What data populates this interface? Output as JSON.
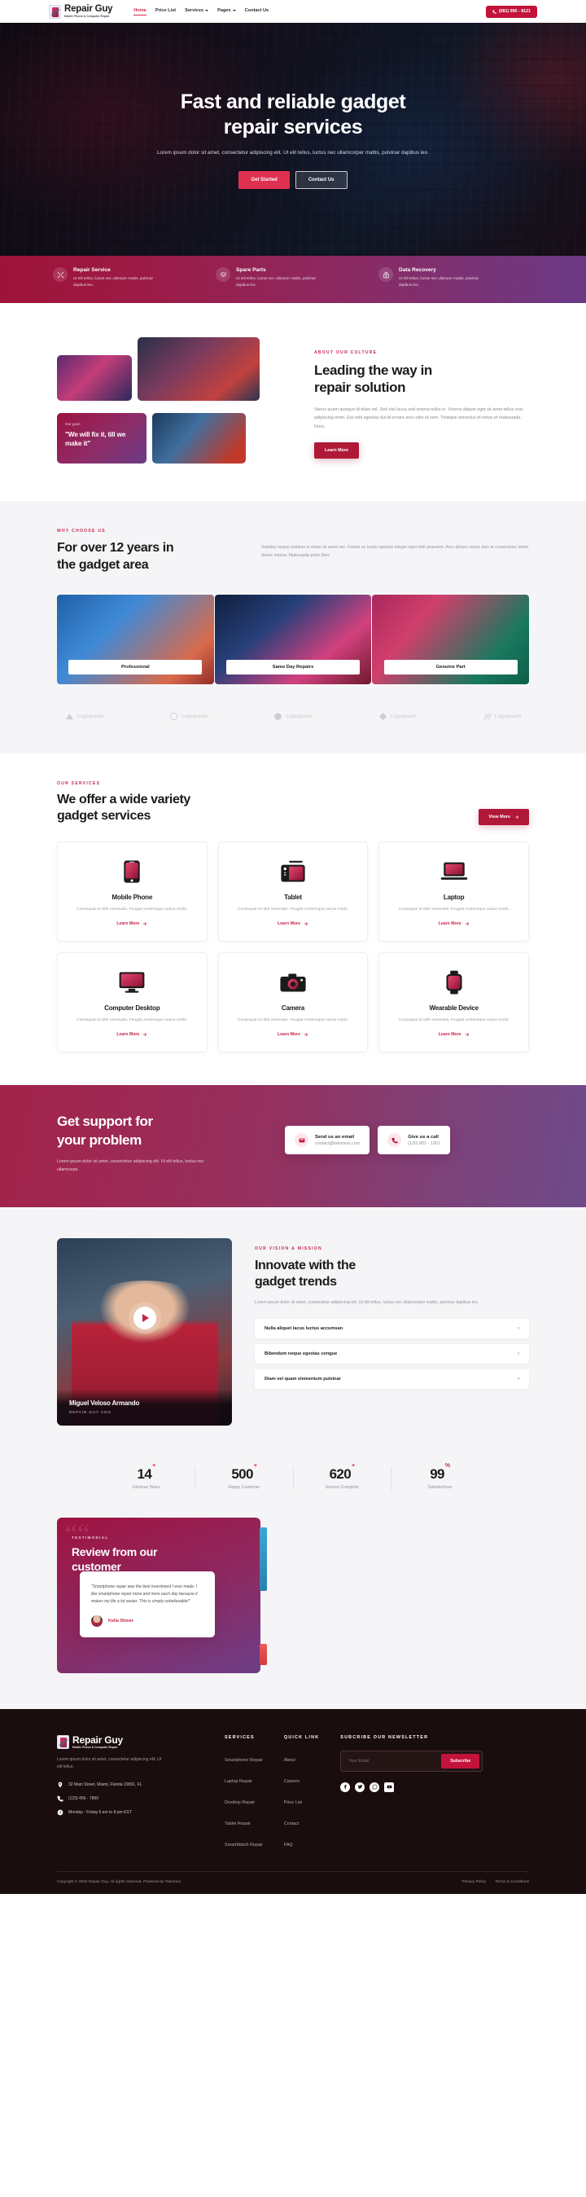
{
  "brand": {
    "name": "Repair Guy",
    "tagline": "Mobile Phone & Computer Repair"
  },
  "nav": {
    "items": [
      {
        "label": "Home",
        "active": true,
        "caret": false
      },
      {
        "label": "Price List",
        "active": false,
        "caret": false
      },
      {
        "label": "Services",
        "active": false,
        "caret": true
      },
      {
        "label": "Pages",
        "active": false,
        "caret": true
      },
      {
        "label": "Contact Us",
        "active": false,
        "caret": false
      }
    ],
    "phone": "(081) 900 - 8121"
  },
  "hero": {
    "title_line1": "Fast and reliable gadget",
    "title_line2": "repair services",
    "subtitle": "Lorem ipsum dolor sit amet, consectetur adipiscing elit. Ut elit tellus, luctus nec ullamcorper mattis, pulvinar dapibus leo.",
    "primary_btn": "Get Started",
    "secondary_btn": "Contact Us"
  },
  "features": [
    {
      "icon": "tools-icon",
      "title": "Repair Service",
      "desc": "Ut elit tellus, luctus nec ullamper mattis, pulvinar dapibus leo."
    },
    {
      "icon": "layers-icon",
      "title": "Spare Parts",
      "desc": "Ut elit tellus, luctus nec ullamper mattis, pulvinar dapibus leo."
    },
    {
      "icon": "lock-icon",
      "title": "Data Recovery",
      "desc": "Ut elit tellus, luctus nec ullamper mattis, pulvinar dapibus leo."
    }
  ],
  "about": {
    "eyebrow": "ABOUT OUR CULTURE",
    "title_line1": "Leading the way in",
    "title_line2": "repair solution",
    "body": "Varius quam quisque id diam vel. Sed nisi lacus sed viverra tellus in. Viverra aliquet eget sit amet tellus cras adipiscing enim. Est velit egestas dui id ornare arcu odio ut sem. Tristique senectus et netus et malesuada. Nunc.",
    "button": "Learn More",
    "goal_label": "Our goal:",
    "goal_quote": "\"We will fix it, till we make it\""
  },
  "why": {
    "eyebrow": "WHY CHOOSE US",
    "title_line1": "For over 12 years in",
    "title_line2": "the gadget area",
    "body": "Sodales neque sodales ut etiam sit amet nisl. Fames ac turpis egestas integer eget nibh praesent. Arcu dictum varius duis at consectetur lorem donec massa. Malesuada proin liber.",
    "pills": [
      "Professional",
      "Same Day Repairs",
      "Genuine Part"
    ],
    "logos": [
      "Logoipsum",
      "Logoipsum",
      "Logoipsum",
      "Logoipsum",
      "Logoipsum"
    ]
  },
  "services": {
    "eyebrow": "OUR SERVICES",
    "title_line1": "We offer a wide variety",
    "title_line2": "gadget services",
    "view_more": "View More",
    "cards": [
      {
        "icon": "mobile-phone-icon",
        "title": "Mobile Phone",
        "desc": "Consequat id nibh venenatis. Feugiat scelerisque varius morbi.",
        "link": "Learn More"
      },
      {
        "icon": "tablet-icon",
        "title": "Tablet",
        "desc": "Consequat id nibh venenatis. Feugiat scelerisque varius morbi.",
        "link": "Learn More"
      },
      {
        "icon": "laptop-icon",
        "title": "Laptop",
        "desc": "Consequat id nibh venenatis. Feugiat scelerisque varius morbi.",
        "link": "Learn More"
      },
      {
        "icon": "desktop-icon",
        "title": "Computer Desktop",
        "desc": "Consequat id nibh venenatis. Feugiat scelerisque varius morbi.",
        "link": "Learn More"
      },
      {
        "icon": "camera-icon",
        "title": "Camera",
        "desc": "Consequat id nibh venenatis. Feugiat scelerisque varius morbi.",
        "link": "Learn More"
      },
      {
        "icon": "smartwatch-icon",
        "title": "Wearable Device",
        "desc": "Consequat id nibh venenatis. Feugiat scelerisque varius morbi.",
        "link": "Learn More"
      }
    ]
  },
  "support": {
    "title_line1": "Get support for",
    "title_line2": "your problem",
    "body": "Lorem ipsum dolor sit amet, consectetur adipiscing elit. Ut elit tellus, luctus nec ullamcorpe.",
    "email_card": {
      "title": "Send us an email",
      "value": "contact@tokomoo.com"
    },
    "call_card": {
      "title": "Give us a call",
      "value": "(120) 801 - 1901"
    }
  },
  "vision": {
    "eyebrow": "OUR VISION & MISSION",
    "title_line1": "Innovate with the",
    "title_line2": "gadget trends",
    "body": "Lorem ipsum dolor sit amet, consectetur adipiscing elit. Ut elit tellus, luctus nec ullamcorper mattis, pulvinar dapibus leo.",
    "accordion": [
      "Nulla aliquet lacus luctus accumsan",
      "Bibendum neque egestas congue",
      "Diam vel quam elementum pulvinar"
    ],
    "video_name": "Miguel Veloso Armando",
    "video_role": "REPAIR GUY CEO"
  },
  "stats": [
    {
      "value": "14",
      "suffix": "+",
      "label": "Glorious Years"
    },
    {
      "value": "500",
      "suffix": "+",
      "label": "Happy Customer"
    },
    {
      "value": "620",
      "suffix": "+",
      "label": "Service Complete"
    },
    {
      "value": "99",
      "suffix": "%",
      "label": "Satisfactions"
    }
  ],
  "testimonial": {
    "eyebrow": "TESTIMONIAL",
    "title_line1": "Review from our",
    "title_line2": "customer",
    "quote": "\"Smartphone repair was the best investment I ever made. I like smartphone repair more and more each day because it makes my life a lot easier. This is simply unbelievable!\"",
    "author": "Keila Shiver"
  },
  "footer": {
    "desc": "Lorem ipsum dolor sit amet, consectetur adipiscing elit. Ut elit tellus.",
    "address": "32 Main Street, Miami, Florida 19091, FL",
    "phone": "(123) 456 - 7890",
    "hours": "Monday - Friday 6 am to 8 pm EST",
    "services_title": "SERVICES",
    "services": [
      "Smartphone Repair",
      "Laptop Repair",
      "Desktop Repair",
      "Tablet Repair",
      "SmartWatch Repair"
    ],
    "quick_title": "QUICK LINK",
    "quick": [
      "About",
      "Careers",
      "Price List",
      "Contact",
      "FAQ"
    ],
    "news_title": "SUBCRIBE OUR NEWSLETTER",
    "news_placeholder": "Your Email",
    "news_value": "",
    "subscribe": "Subscribe",
    "copyright": "Copyright © 2022 Repair Guy, All rights reserved. Powered by Tokomoo.",
    "privacy": "Privacy Policy",
    "terms": "Terms & Conditions"
  },
  "colors": {
    "accent": "#c3133b",
    "accent_light": "#e03050",
    "pink": "#d12a4a",
    "dark": "#1a0d0d"
  }
}
